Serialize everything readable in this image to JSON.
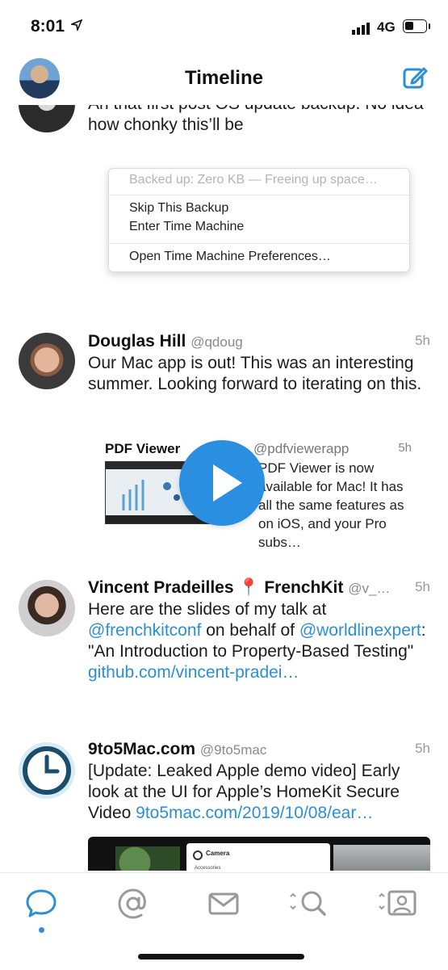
{
  "status": {
    "time": "8:01",
    "network": "4G"
  },
  "nav": {
    "title": "Timeline"
  },
  "tweet0": {
    "text": "An that first post OS update backup. No idea how chonky this’ll be"
  },
  "menu": {
    "header": "Backed up: Zero KB — Freeing up space…",
    "items": [
      "Skip This Backup",
      "Enter Time Machine",
      "Open Time Machine Preferences…"
    ]
  },
  "tweets": [
    {
      "name": "Douglas Hill",
      "handle": "@qdoug",
      "age": "5h",
      "text": "Our Mac app is out! This was an interesting summer. Looking forward to iterating on this.",
      "quote": {
        "name": "PDF Viewer",
        "handle": "@pdfviewerapp",
        "age": "5h",
        "text": "PDF Viewer is now available for Mac! It has all the same features as on iOS, and your Pro subs…"
      }
    },
    {
      "name": "Vincent Pradeilles 📍 FrenchKit",
      "handle": "@v_…",
      "age": "5h",
      "text_a": "Here are the slides of my talk at ",
      "link_a": "@frenchkitconf",
      "text_b": " on behalf of ",
      "link_b": "@worldlinexpert",
      "text_c": ": \"An Introduction to Property-Based Testing\" ",
      "link_c": "github.com/vincent-pradei…"
    },
    {
      "name": "9to5Mac.com",
      "handle": "@9to5mac",
      "age": "5h",
      "text": "[Update: Leaked Apple demo video] Early look at the UI for Apple’s HomeKit Secure Video ",
      "link": "9to5mac.com/2019/10/08/ear…",
      "media_card": {
        "title": "Camera",
        "sub": "Accessories"
      }
    }
  ],
  "tabs": [
    "timeline-tab",
    "mentions-tab",
    "messages-tab",
    "search-tab",
    "profile-tab"
  ],
  "colors": {
    "accent": "#2c8fd6"
  }
}
